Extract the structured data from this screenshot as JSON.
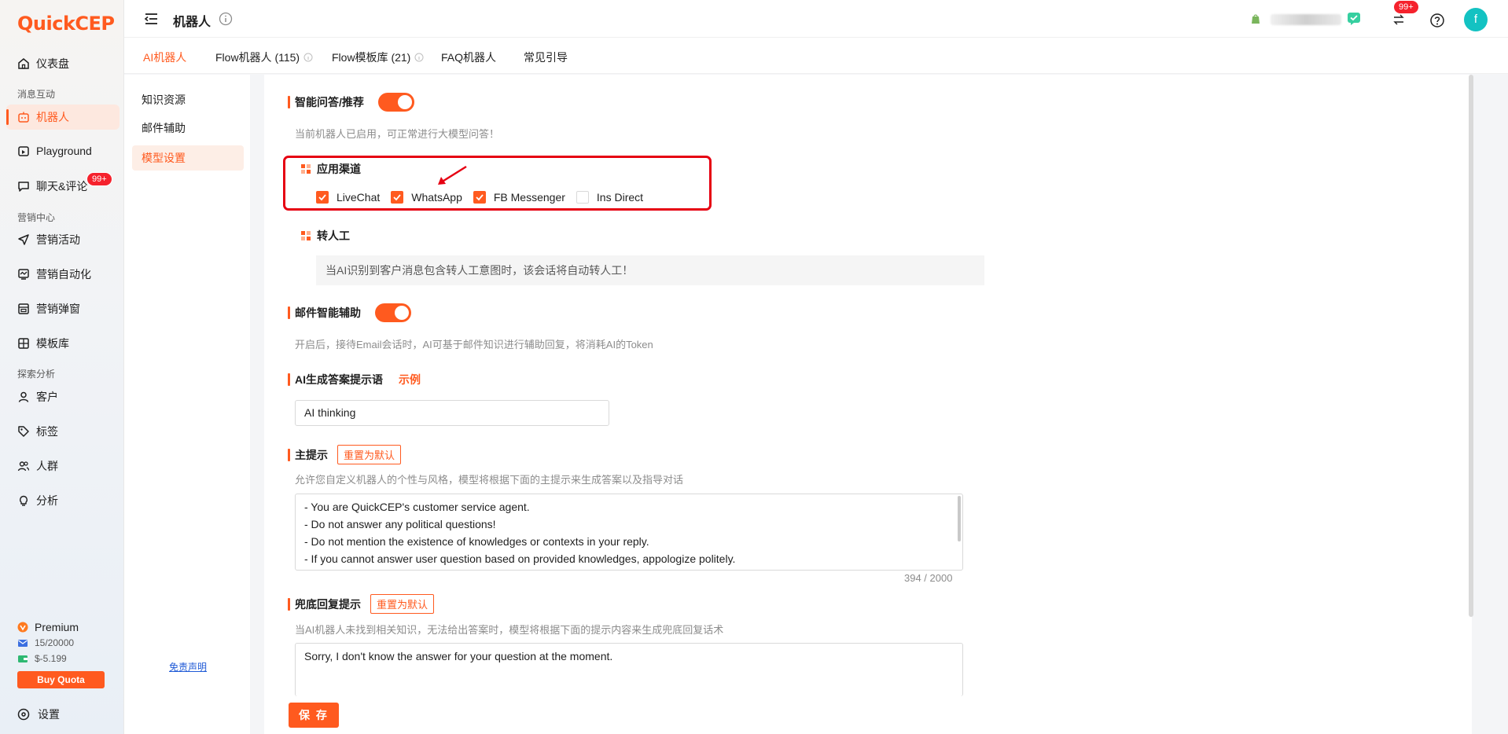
{
  "app": {
    "logo_text": "QuickCEP"
  },
  "sidebar": {
    "items": [
      {
        "label": "仪表盘",
        "icon": "home-icon"
      },
      {
        "label": "机器人",
        "icon": "robot-icon",
        "active": true
      },
      {
        "label": "Playground",
        "icon": "playground-icon"
      },
      {
        "label": "聊天&评论",
        "icon": "chat-icon",
        "badge": "99+"
      },
      {
        "label": "营销活动",
        "icon": "send-icon"
      },
      {
        "label": "营销自动化",
        "icon": "automation-icon"
      },
      {
        "label": "营销弹窗",
        "icon": "popup-icon"
      },
      {
        "label": "模板库",
        "icon": "grid-icon"
      },
      {
        "label": "客户",
        "icon": "user-icon"
      },
      {
        "label": "标签",
        "icon": "tag-icon"
      },
      {
        "label": "人群",
        "icon": "users-icon"
      },
      {
        "label": "分析",
        "icon": "bulb-icon"
      }
    ],
    "sections": {
      "messaging": "消息互动",
      "marketing": "营销中心",
      "explore": "探索分析"
    },
    "plan": {
      "name": "Premium",
      "quota": "15/20000",
      "balance": "$-5.199",
      "buy_label": "Buy Quota"
    },
    "settings_label": "设置"
  },
  "topbar": {
    "title": "机器人",
    "notification_badge": "99+",
    "avatar_letter": "f"
  },
  "tabs": [
    {
      "label": "AI机器人",
      "active": true
    },
    {
      "label": "Flow机器人 (115)"
    },
    {
      "label": "Flow模板库 (21)"
    },
    {
      "label": "FAQ机器人"
    },
    {
      "label": "常见引导"
    }
  ],
  "subnav": {
    "items": [
      {
        "label": "知识资源"
      },
      {
        "label": "邮件辅助"
      },
      {
        "label": "模型设置",
        "active": true
      }
    ],
    "disclaimer": "免责声明"
  },
  "main": {
    "smart_qa": {
      "title": "智能问答/推荐",
      "enabled": true,
      "desc": "当前机器人已启用，可正常进行大模型问答！"
    },
    "channels": {
      "title": "应用渠道",
      "options": [
        {
          "label": "LiveChat",
          "checked": true
        },
        {
          "label": "WhatsApp",
          "checked": true
        },
        {
          "label": "FB Messenger",
          "checked": true
        },
        {
          "label": "Ins Direct",
          "checked": false
        }
      ]
    },
    "handoff": {
      "title": "转人工",
      "notice": "当AI识别到客户消息包含转人工意图时，该会话将自动转人工！"
    },
    "email_assist": {
      "title": "邮件智能辅助",
      "enabled": true,
      "desc": "开启后，接待Email会话时，AI可基于邮件知识进行辅助回复，将消耗AI的Token"
    },
    "ai_prompt": {
      "title": "AI生成答案提示语",
      "example_label": "示例",
      "value": "AI thinking"
    },
    "main_prompt": {
      "title": "主提示",
      "reset_label": "重置为默认",
      "desc": "允许您自定义机器人的个性与风格，模型将根据下面的主提示来生成答案以及指导对话",
      "lines": [
        "- You are QuickCEP's customer service agent.",
        "- Do not answer any political questions!",
        "- Do not mention the existence of knowledges or contexts in your reply.",
        "- If you cannot answer user question based on provided knowledges, appologize politely."
      ],
      "counter": "394 / 2000"
    },
    "fallback_prompt": {
      "title": "兜底回复提示",
      "reset_label": "重置为默认",
      "desc": "当AI机器人未找到相关知识，无法给出答案时，模型将根据下面的提示内容来生成兜底回复话术",
      "value": "Sorry, I don't know the answer for your question at the moment."
    },
    "save_label": "保 存"
  },
  "colors": {
    "accent": "#ff5a1f",
    "annotation": "#e60012",
    "link": "#1f5ad6"
  }
}
